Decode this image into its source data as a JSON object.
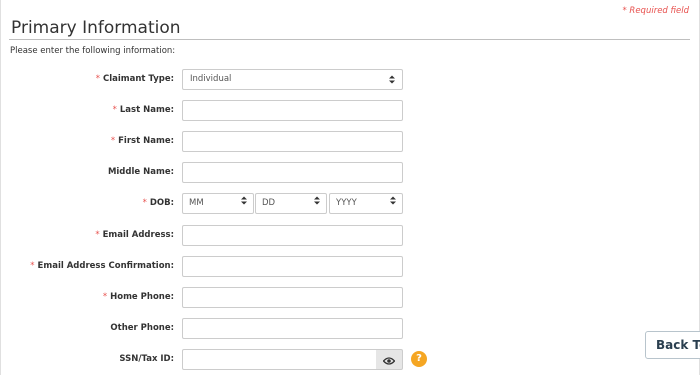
{
  "required_note": "* Required field",
  "section_title": "Primary Information",
  "instructions": "Please enter the following information:",
  "required_marker": "*",
  "fields": {
    "claimant_type": {
      "label": "Claimant Type:",
      "required": true,
      "value": "Individual"
    },
    "last_name": {
      "label": "Last Name:",
      "required": true,
      "value": ""
    },
    "first_name": {
      "label": "First Name:",
      "required": true,
      "value": ""
    },
    "middle_name": {
      "label": "Middle Name:",
      "required": false,
      "value": ""
    },
    "dob": {
      "label": "DOB:",
      "required": true,
      "month": "MM",
      "day": "DD",
      "year": "YYYY"
    },
    "email": {
      "label": "Email Address:",
      "required": true,
      "value": ""
    },
    "email_confirm": {
      "label": "Email Address Confirmation:",
      "required": true,
      "value": ""
    },
    "home_phone": {
      "label": "Home Phone:",
      "required": true,
      "value": ""
    },
    "other_phone": {
      "label": "Other Phone:",
      "required": false,
      "value": ""
    },
    "ssn": {
      "label": "SSN/Tax ID:",
      "required": false,
      "value": ""
    }
  },
  "help_icon_text": "?",
  "back_button": "Back To",
  "colors": {
    "required": "#e8524f",
    "help": "#f5a623",
    "button_text": "#2a3f4f"
  },
  "icons": [
    "chevron-updown-icon",
    "eye-icon",
    "help-icon"
  ]
}
